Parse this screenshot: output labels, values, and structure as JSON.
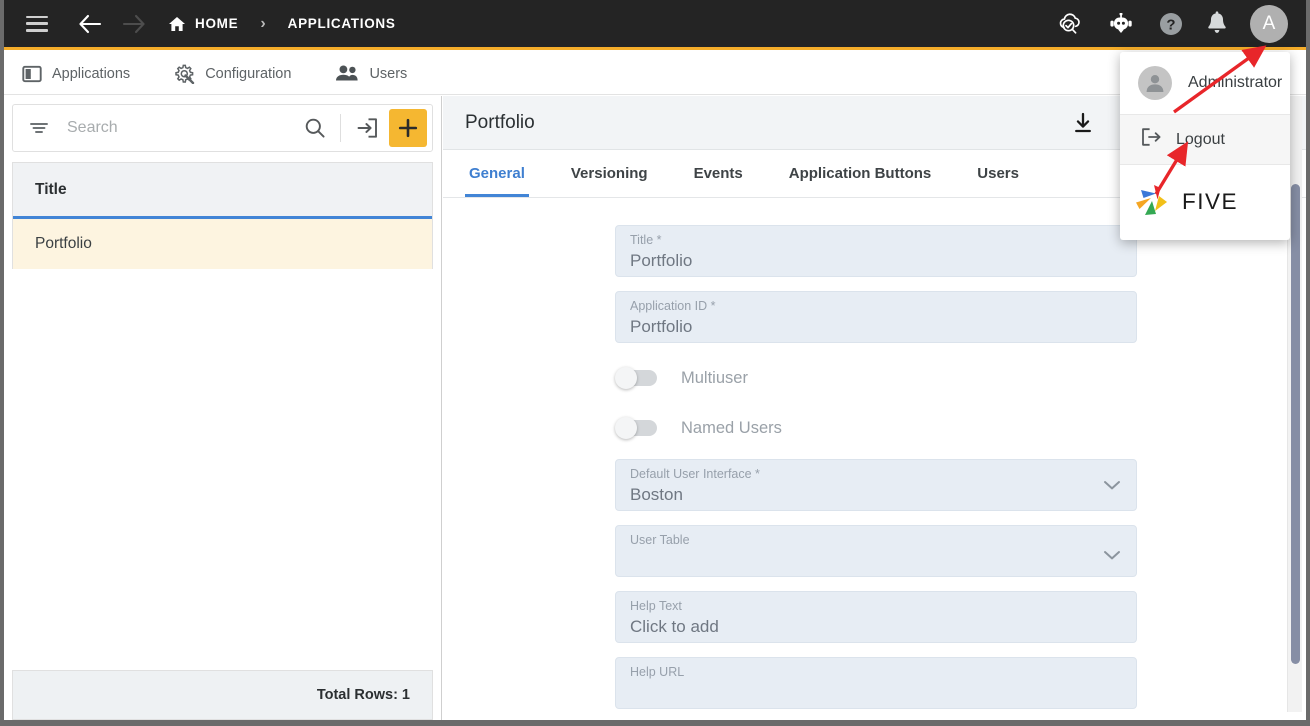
{
  "topbar": {
    "menu_icon": "hamburger-icon",
    "back_icon": "arrow-back-icon",
    "forward_icon": "arrow-forward-icon",
    "breadcrumbs": [
      {
        "label": "HOME",
        "icon": "home-icon"
      },
      {
        "label": "APPLICATIONS",
        "icon": ""
      }
    ],
    "separator": "›",
    "actions": [
      {
        "name": "cloud-check-icon"
      },
      {
        "name": "robot-chat-icon"
      },
      {
        "name": "help-circle-icon"
      },
      {
        "name": "bell-icon"
      }
    ],
    "avatar_letter": "A",
    "accent_color": "#f5ad2a",
    "background_color": "#242424"
  },
  "module_tabs": [
    {
      "label": "Applications",
      "icon": "panel-icon"
    },
    {
      "label": "Configuration",
      "icon": "gear-wrench-icon"
    },
    {
      "label": "Users",
      "icon": "users-icon"
    }
  ],
  "left_panel": {
    "search": {
      "placeholder": "Search",
      "value": "",
      "filter_icon": "filter-icon",
      "search_icon": "search-icon"
    },
    "import_icon": "import-arrow-icon",
    "add_button": {
      "label": "+",
      "color": "#f5b731"
    },
    "grid": {
      "columns": [
        "Title"
      ],
      "rows": [
        {
          "title": "Portfolio"
        }
      ]
    },
    "footer": {
      "total_rows_label": "Total Rows: 1"
    }
  },
  "detail": {
    "title": "Portfolio",
    "toolbar": [
      {
        "name": "download-icon",
        "color": "#1a1a1a"
      },
      {
        "name": "run-arrow-circle-icon",
        "color": "#2f7fe0"
      },
      {
        "name": "history-clock-icon",
        "color": "#bfc3c6"
      },
      {
        "name": "copy-icon",
        "color": "#5e6468"
      }
    ],
    "tabs": [
      {
        "label": "General",
        "active": true
      },
      {
        "label": "Versioning",
        "active": false
      },
      {
        "label": "Events",
        "active": false
      },
      {
        "label": "Application Buttons",
        "active": false
      },
      {
        "label": "Users",
        "active": false
      }
    ],
    "fields": [
      {
        "type": "text",
        "label": "Title *",
        "value": "Portfolio"
      },
      {
        "type": "text",
        "label": "Application ID *",
        "value": "Portfolio"
      },
      {
        "type": "toggle",
        "label": "Multiuser",
        "value": "off"
      },
      {
        "type": "toggle",
        "label": "Named Users",
        "value": "off"
      },
      {
        "type": "select",
        "label": "Default User Interface *",
        "value": "Boston"
      },
      {
        "type": "select",
        "label": "User Table",
        "value": ""
      },
      {
        "type": "text",
        "label": "Help Text",
        "value": "Click to add"
      },
      {
        "type": "text",
        "label": "Help URL",
        "value": ""
      }
    ]
  },
  "account_menu": {
    "user_name": "Administrator",
    "user_icon": "person-avatar-icon",
    "items": [
      {
        "label": "Logout",
        "icon": "logout-icon"
      }
    ],
    "brand": {
      "label": "FIVE",
      "logo_icon": "five-pinwheel-logo-icon"
    }
  },
  "annotations": {
    "arrow_color": "#e8262a",
    "arrows": [
      {
        "name": "annotation-arrow-to-avatar",
        "target": "avatar-button"
      },
      {
        "name": "annotation-arrow-to-logout",
        "target": "logout-menu-item"
      }
    ]
  },
  "scrollbar": {
    "name": "vertical-scrollbar",
    "thumb_color": "#868ea5"
  }
}
